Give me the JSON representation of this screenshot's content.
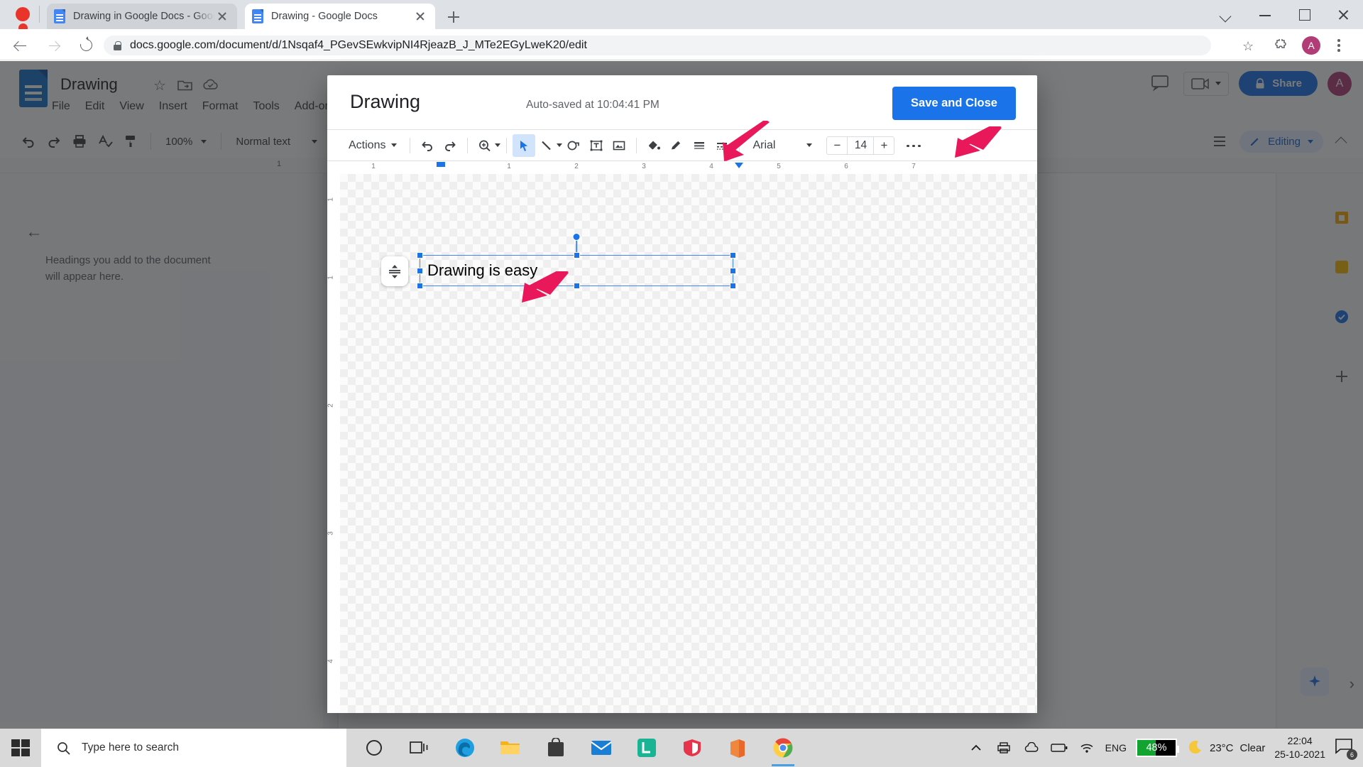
{
  "browser": {
    "tabs": [
      {
        "title": "Drawing in Google Docs - Google",
        "active": false
      },
      {
        "title": "Drawing - Google Docs",
        "active": true
      }
    ],
    "url": "docs.google.com/document/d/1Nsqaf4_PGevSEwkvipNI4RjeazB_J_MTe2EGyLweK20/edit",
    "avatar_letter": "A",
    "icons": {
      "back": "back-arrow-icon",
      "forward": "forward-arrow-icon",
      "reload": "reload-icon",
      "lock": "lock-icon",
      "star": "star-icon",
      "extensions": "puzzle-piece-icon",
      "menu": "kebab-menu-icon",
      "minimize": "minimize-icon",
      "maximize": "maximize-icon",
      "close": "close-icon",
      "chevron": "chevron-down-icon"
    }
  },
  "docs": {
    "title": "Drawing",
    "menu": [
      "File",
      "Edit",
      "View",
      "Insert",
      "Format",
      "Tools",
      "Add-ons"
    ],
    "toolbar": {
      "zoom": "100%",
      "style": "Normal text",
      "icons": [
        "undo-icon",
        "redo-icon",
        "print-icon",
        "spelling-check-icon",
        "paint-format-icon"
      ]
    },
    "editing_mode": "Editing",
    "share_label": "Share",
    "avatar_letter": "A",
    "outline_placeholder": "Headings you add to the document will appear here.",
    "ruler_label": "1"
  },
  "drawing_dialog": {
    "title": "Drawing",
    "autosave": "Auto-saved at 10:04:41 PM",
    "save_close_label": "Save and Close",
    "toolbar": {
      "actions_label": "Actions",
      "font": "Arial",
      "font_size": "14",
      "decrease_label": "−",
      "increase_label": "+",
      "tools": [
        "undo-icon",
        "redo-icon",
        "zoom-icon",
        "select-cursor-icon",
        "line-icon",
        "shape-icon",
        "text-box-icon",
        "image-icon",
        "fill-color-icon",
        "line-color-icon",
        "line-weight-icon",
        "line-dash-icon"
      ]
    },
    "canvas": {
      "text_box_value": "Drawing is easy",
      "h_ruler_labels": [
        "1",
        "1",
        "2",
        "3",
        "4",
        "5",
        "6",
        "7"
      ],
      "v_ruler_labels": [
        "1",
        "1",
        "2",
        "3",
        "4"
      ]
    }
  },
  "taskbar": {
    "search_placeholder": "Type here to search",
    "battery_percent": "48%",
    "weather_temp": "23°C",
    "weather_condition": "Clear",
    "time": "22:04",
    "date": "25-10-2021",
    "language": "ENG",
    "notification_count": "6",
    "app_icons": [
      "cortana-icon",
      "task-view-icon",
      "edge-icon",
      "file-explorer-icon",
      "store-icon",
      "mail-icon",
      "l-app-icon",
      "m-app-icon",
      "office-icon",
      "chrome-icon"
    ]
  }
}
